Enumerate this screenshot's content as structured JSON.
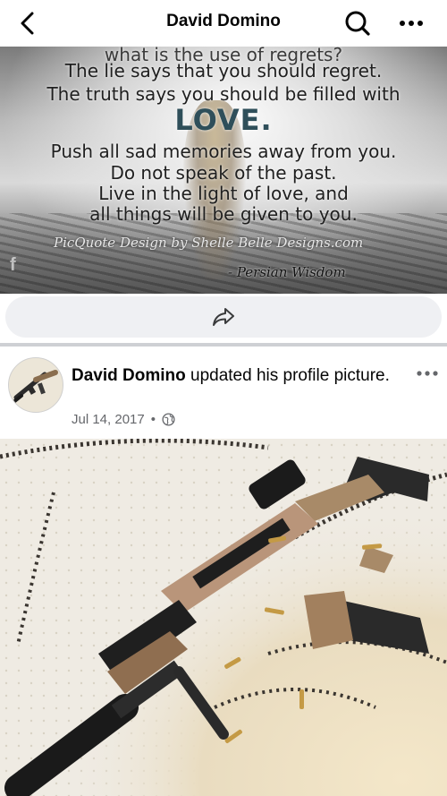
{
  "header": {
    "title": "David Domino",
    "back_icon": "back-arrow-icon",
    "search_icon": "search-icon",
    "more_icon": "more-horizontal-icon"
  },
  "quote_post": {
    "lines": [
      "what is the use of regrets?",
      "The lie says that you should regret.",
      "The truth says you should be filled with",
      "LOVE.",
      "Push all sad memories away from you.",
      "Do not speak of the past.",
      "Live in the light of love, and",
      "all things will be given to you."
    ],
    "credit": "PicQuote Design by Shelle Belle Designs.com",
    "signature": "- Persian Wisdom",
    "share_icon": "share-icon"
  },
  "profile_post": {
    "author": "David Domino",
    "action": " updated his profile picture.",
    "date": "Jul 14, 2017",
    "separator": "•",
    "privacy_icon": "globe-icon",
    "more_icon": "more-horizontal-icon"
  },
  "colors": {
    "divider": "#ced0d4",
    "share_bar_bg": "#eff0f3",
    "meta_text": "#65676b"
  }
}
